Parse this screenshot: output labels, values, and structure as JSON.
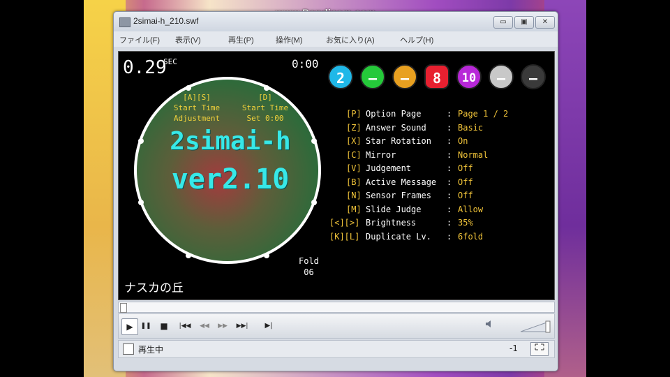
{
  "watermark": "www.Bandicam.com",
  "window": {
    "title": "2simai-h_210.swf",
    "buttons": [
      "▭",
      "▣",
      "✕"
    ]
  },
  "menu": [
    "ファイル(F)",
    "表示(V)",
    "再生(P)",
    "操作(M)",
    "お気に入り(A)",
    "ヘルプ(H)"
  ],
  "game": {
    "timer": "0.29",
    "timer_unit": "SEC",
    "clock": "0:00",
    "left_key": "[A][S]",
    "left_label_1": "Start Time",
    "left_label_2": "Adjustment",
    "right_key": "[D]",
    "right_label_1": "Start Time",
    "right_label_2": "Set 0:00",
    "title_line1": "2simai-h",
    "title_line2": "ver2.10",
    "fold_label": "Fold",
    "fold_value": "06",
    "song": "ナスカの丘",
    "badges": [
      {
        "text": "2",
        "color": "#20b8e8"
      },
      {
        "text": "–",
        "color": "#25c93a"
      },
      {
        "text": "–",
        "color": "#e8a020"
      },
      {
        "text": "8",
        "color": "#e82030"
      },
      {
        "text": "10",
        "color": "#b828d8"
      },
      {
        "text": "–",
        "color": "#c8c8c8"
      },
      {
        "text": "–",
        "color": "#3a3a3a"
      }
    ],
    "options": [
      {
        "key": "[P]",
        "name": "Option Page",
        "value": "Page 1 / 2"
      },
      {
        "key": "[Z]",
        "name": "Answer Sound",
        "value": "Basic"
      },
      {
        "key": "[X]",
        "name": "Star Rotation",
        "value": "On"
      },
      {
        "key": "[C]",
        "name": "Mirror",
        "value": "Normal"
      },
      {
        "key": "[V]",
        "name": "Judgement",
        "value": "Off"
      },
      {
        "key": "[B]",
        "name": "Active Message",
        "value": "Off"
      },
      {
        "key": "[N]",
        "name": "Sensor Frames",
        "value": "Off"
      },
      {
        "key": "[M]",
        "name": "Slide Judge",
        "value": "Allow"
      },
      {
        "key": "[<][>]",
        "name": "Brightness",
        "value": "35%"
      },
      {
        "key": "[K][L]",
        "name": "Duplicate Lv.",
        "value": "6fold"
      }
    ]
  },
  "player": {
    "buttons": [
      "▶",
      "❚❚",
      "■",
      "|◀◀",
      "◀◀",
      "▶▶",
      "▶▶|",
      "▶|"
    ],
    "status_text": "再生中",
    "status_number": "-1"
  }
}
